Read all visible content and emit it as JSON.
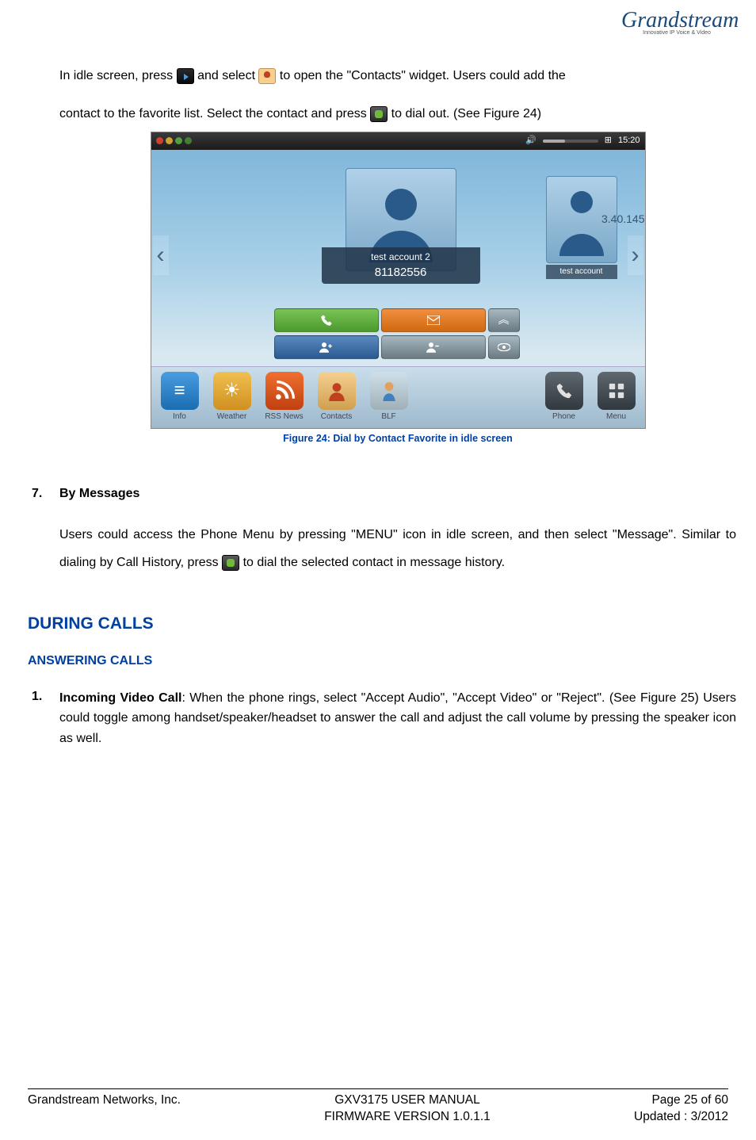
{
  "logo": {
    "brand": "Grandstream",
    "tagline": "Innovative IP Voice & Video"
  },
  "body": {
    "p1a": "In idle screen, press ",
    "p1b": " and select ",
    "p1c": "to open the \"Contacts\" widget. Users could add the",
    "p2a": "contact to the favorite list. Select the contact and press ",
    "p2b": " to dial out. (See Figure 24)"
  },
  "screenshot": {
    "time": "15:20",
    "contact_name": "test account 2",
    "contact_number": "81182556",
    "side_label": "test account",
    "ip": "3.40.145",
    "dock": {
      "info": "Info",
      "weather": "Weather",
      "rss": "RSS News",
      "contacts": "Contacts",
      "blf": "BLF",
      "phone": "Phone",
      "menu": "Menu"
    }
  },
  "figure_caption": "Figure 24: Dial by Contact Favorite in idle screen",
  "section7": {
    "num": "7.",
    "title": "By Messages",
    "p_a": "Users could access the Phone Menu by pressing \"MENU\" icon in idle screen, and then select \"Message\". Similar to dialing by Call History, press ",
    "p_b": " to dial the selected contact in message history."
  },
  "h1": "DURING CALLS",
  "h2": "ANSWERING CALLS",
  "item1": {
    "num": "1.",
    "title": "Incoming Video Call",
    "rest": ": When the phone rings, select \"Accept Audio\", \"Accept Video\" or \"Reject\". (See Figure 25) Users could toggle among handset/speaker/headset to answer the call and adjust the call volume by pressing the speaker icon as well."
  },
  "footer": {
    "company": "Grandstream Networks, Inc.",
    "manual": "GXV3175 USER MANUAL",
    "firmware": "FIRMWARE VERSION 1.0.1.1",
    "page": "Page 25 of 60",
    "updated": "Updated : 3/2012"
  }
}
